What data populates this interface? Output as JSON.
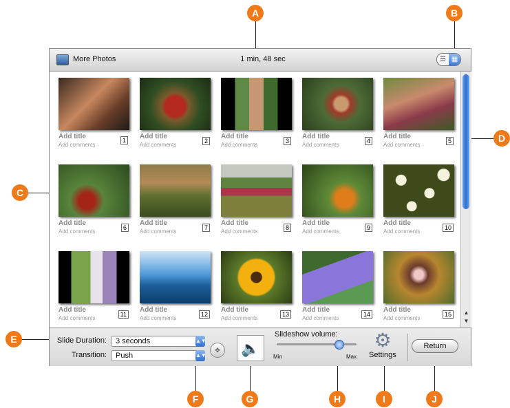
{
  "callouts": [
    "A",
    "B",
    "C",
    "D",
    "E",
    "F",
    "G",
    "H",
    "I",
    "J"
  ],
  "window": {
    "album_name": "More Photos",
    "duration": "1 min, 48 sec",
    "view_toggle": {
      "list_icon": "list-view-icon",
      "grid_icon": "grid-view-icon",
      "selected": "grid"
    }
  },
  "photos": [
    {
      "number": "1",
      "title": "Add title",
      "comments": "Add comments"
    },
    {
      "number": "2",
      "title": "Add title",
      "comments": "Add comments"
    },
    {
      "number": "3",
      "title": "Add title",
      "comments": "Add comments"
    },
    {
      "number": "4",
      "title": "Add title",
      "comments": "Add comments"
    },
    {
      "number": "5",
      "title": "Add title",
      "comments": "Add comments"
    },
    {
      "number": "6",
      "title": "Add title",
      "comments": "Add comments"
    },
    {
      "number": "7",
      "title": "Add title",
      "comments": "Add comments"
    },
    {
      "number": "8",
      "title": "Add title",
      "comments": "Add comments"
    },
    {
      "number": "9",
      "title": "Add title",
      "comments": "Add comments"
    },
    {
      "number": "10",
      "title": "Add title",
      "comments": "Add comments"
    },
    {
      "number": "11",
      "title": "Add title",
      "comments": "Add comments"
    },
    {
      "number": "12",
      "title": "Add title",
      "comments": "Add comments"
    },
    {
      "number": "13",
      "title": "Add title",
      "comments": "Add comments"
    },
    {
      "number": "14",
      "title": "Add title",
      "comments": "Add comments"
    },
    {
      "number": "15",
      "title": "Add title",
      "comments": "Add comments"
    }
  ],
  "controls": {
    "slide_duration_label": "Slide Duration:",
    "slide_duration_value": "3 seconds",
    "transition_label": "Transition:",
    "transition_value": "Push",
    "volume_label": "Slideshow volume:",
    "volume_min": "Min",
    "volume_max": "Max",
    "volume_level": 0.78,
    "settings_label": "Settings",
    "return_label": "Return"
  },
  "colors": {
    "callout": "#ef7a1a",
    "accent": "#3d7ad6"
  }
}
